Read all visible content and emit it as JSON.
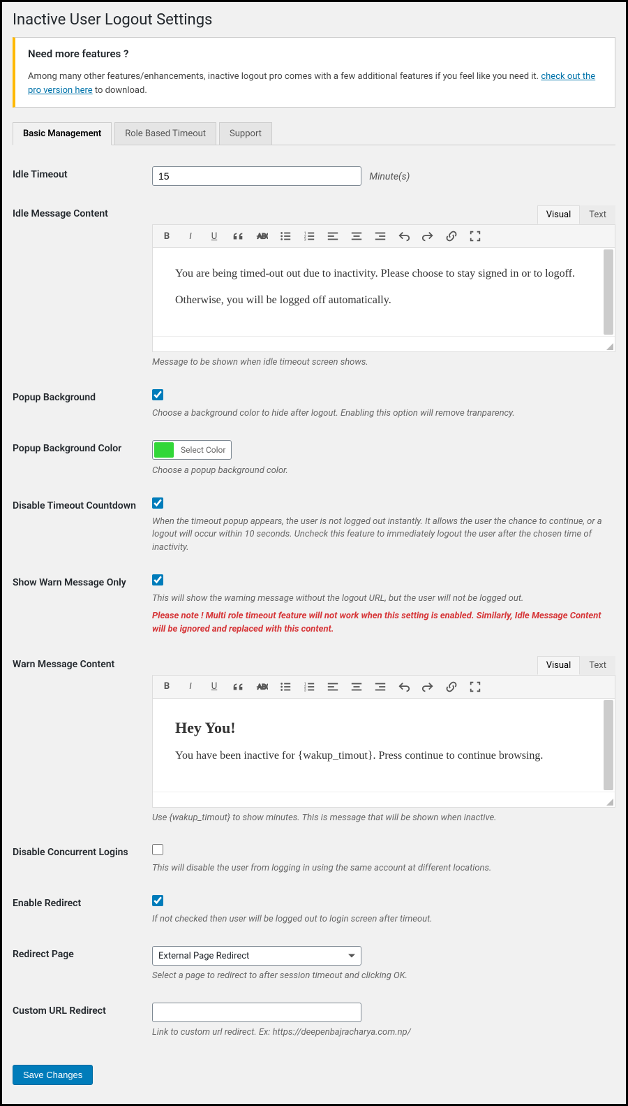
{
  "page_title": "Inactive User Logout Settings",
  "notice": {
    "heading": "Need more features ?",
    "text_before": "Among many other features/enhancements, inactive logout pro comes with a few additional features if you feel like you need it. ",
    "link_text": "check out the pro version here",
    "text_after": " to download."
  },
  "tabs": [
    "Basic Management",
    "Role Based Timeout",
    "Support"
  ],
  "active_tab": 0,
  "editor_tabs": [
    "Visual",
    "Text"
  ],
  "toolbar_icons": [
    "bold",
    "italic",
    "underline",
    "quote",
    "strike",
    "ul",
    "ol",
    "align-left",
    "align-center",
    "align-right",
    "undo",
    "redo",
    "link",
    "fullscreen"
  ],
  "fields": {
    "idle_timeout": {
      "label": "Idle Timeout",
      "value": "15",
      "unit": "Minute(s)"
    },
    "idle_message": {
      "label": "Idle Message Content",
      "body_p1": "You are being timed-out out due to inactivity. Please choose to stay signed in or to logoff.",
      "body_p2": "Otherwise, you will be logged off automatically.",
      "desc": "Message to be shown when idle timeout screen shows."
    },
    "popup_bg": {
      "label": "Popup Background",
      "checked": true,
      "desc": "Choose a background color to hide after logout. Enabling this option will remove tranparency."
    },
    "popup_bg_color": {
      "label": "Popup Background Color",
      "button": "Select Color",
      "desc": "Choose a popup background color."
    },
    "disable_countdown": {
      "label": "Disable Timeout Countdown",
      "checked": true,
      "desc": "When the timeout popup appears, the user is not logged out instantly. It allows the user the chance to continue, or a logout will occur within 10 seconds. Uncheck this feature to immediately logout the user after the chosen time of inactivity."
    },
    "warn_only": {
      "label": "Show Warn Message Only",
      "checked": true,
      "desc": "This will show the warning message without the logout URL, but the user will not be logged out.",
      "warn": "Please note ! Multi role timeout feature will not work when this setting is enabled. Similarly, Idle Message Content will be ignored and replaced with this content."
    },
    "warn_message": {
      "label": "Warn Message Content",
      "heading": "Hey You!",
      "body": "You have been inactive for {wakup_timout}. Press continue to continue browsing.",
      "desc": "Use {wakup_timout} to show minutes. This is message that will be shown when inactive."
    },
    "disable_concurrent": {
      "label": "Disable Concurrent Logins",
      "checked": false,
      "desc": "This will disable the user from logging in using the same account at different locations."
    },
    "enable_redirect": {
      "label": "Enable Redirect",
      "checked": true,
      "desc": "If not checked then user will be logged out to login screen after timeout."
    },
    "redirect_page": {
      "label": "Redirect Page",
      "value": "External Page Redirect",
      "desc": "Select a page to redirect to after session timeout and clicking OK."
    },
    "custom_url": {
      "label": "Custom URL Redirect",
      "value": "",
      "desc": "Link to custom url redirect. Ex: https://deepenbajracharya.com.np/"
    }
  },
  "submit": "Save Changes"
}
